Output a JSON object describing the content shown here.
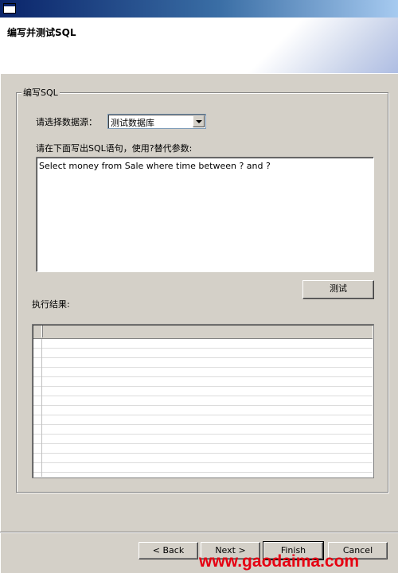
{
  "window": {
    "title": ""
  },
  "banner": {
    "title": "编写并测试SQL"
  },
  "group": {
    "legend": "编写SQL",
    "datasource_label": "请选择数据源：",
    "datasource_value": "测试数据库",
    "sql_instruction": "请在下面写出SQL语句，使用?替代参数:",
    "sql_text": "Select money from Sale where time between ? and ?",
    "test_button": "测试",
    "result_label": "执行结果:"
  },
  "footer": {
    "back": "< Back",
    "next": "Next >",
    "finish": "Finish",
    "cancel": "Cancel"
  },
  "watermark": "www.gaodaima.com"
}
